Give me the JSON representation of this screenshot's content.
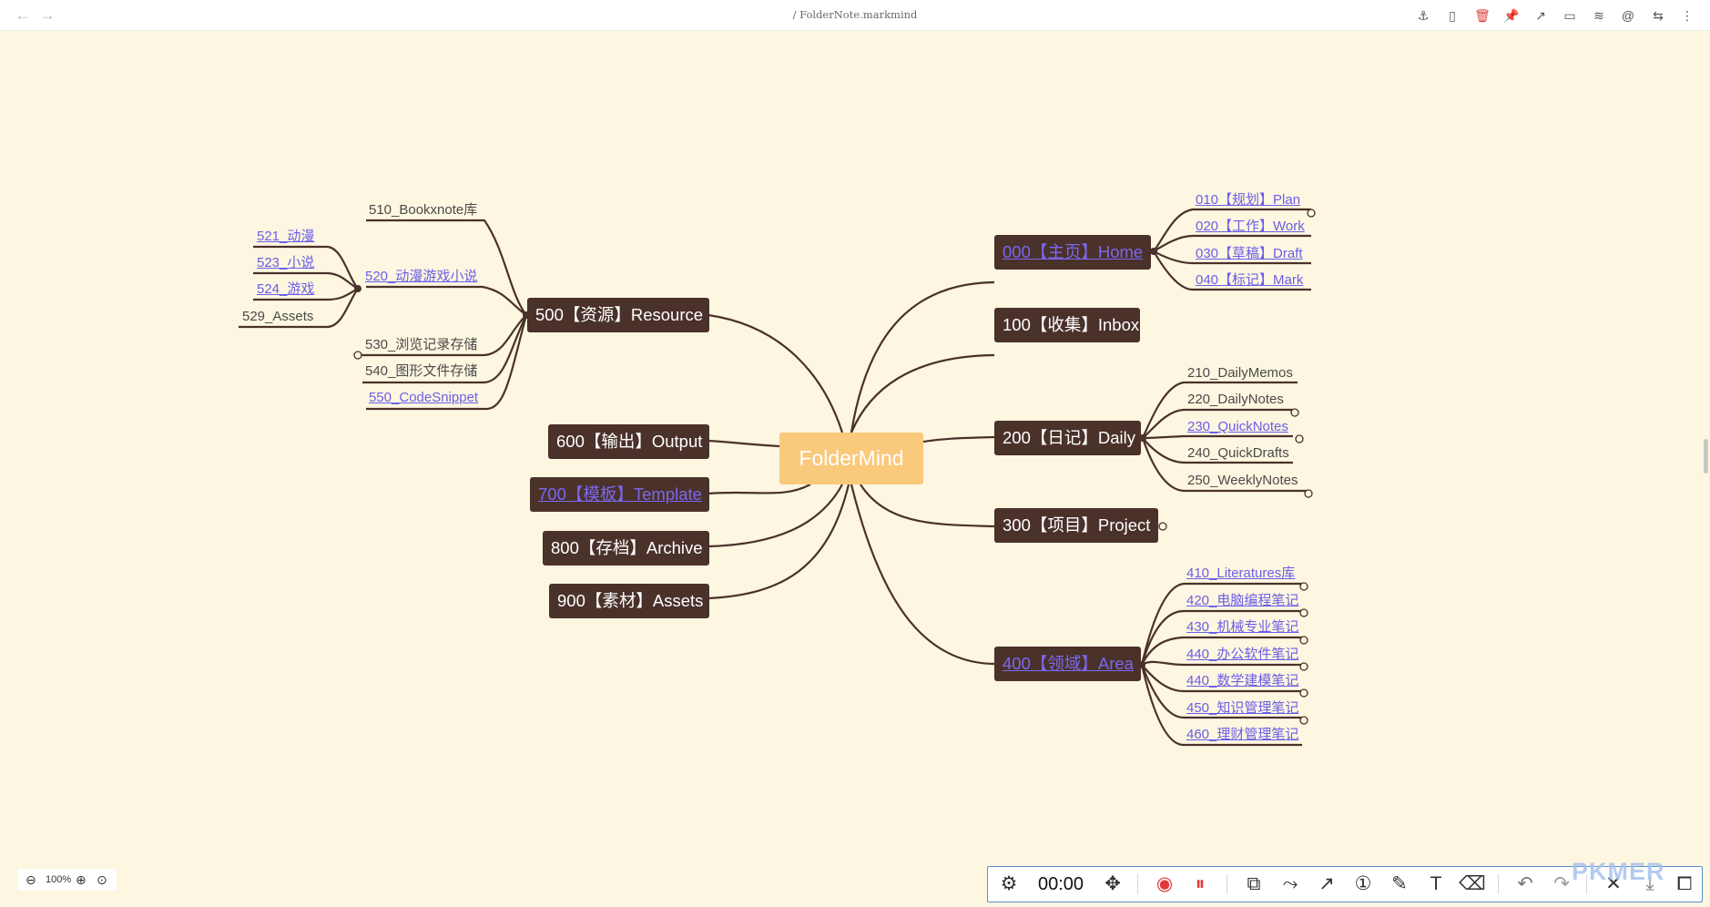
{
  "file_title": "/ FolderNote.markmind",
  "root": "FolderMind",
  "right_nodes": [
    {
      "label": "000【主页】Home",
      "link": true
    },
    {
      "label": "100【收集】Inbox",
      "link": false
    },
    {
      "label": "200【日记】Daily",
      "link": false
    },
    {
      "label": "300【项目】Project",
      "link": false
    },
    {
      "label": "400【领域】Area",
      "link": true
    }
  ],
  "left_nodes": [
    {
      "label": "500【资源】Resource",
      "link": false
    },
    {
      "label": "600【输出】Output",
      "link": false
    },
    {
      "label": "700【模板】Template",
      "link": true
    },
    {
      "label": "800【存档】Archive",
      "link": false
    },
    {
      "label": "900【素材】Assets",
      "link": false
    }
  ],
  "home_children": [
    "010【规划】Plan",
    "020【工作】Work",
    "030【草稿】Draft",
    "040【标记】Mark"
  ],
  "daily_children": [
    "210_DailyMemos",
    "220_DailyNotes",
    "230_QuickNotes",
    "240_QuickDrafts",
    "250_WeeklyNotes"
  ],
  "area_children": [
    "410_Literatures库",
    "420_电脑编程笔记",
    "430_机械专业笔记",
    "440_办公软件笔记",
    "440_数学建模笔记",
    "450_知识管理笔记",
    "460_理财管理笔记"
  ],
  "resource_children": [
    "510_Bookxnote库",
    "520_动漫游戏小说",
    "530_浏览记录存储",
    "540_图形文件存储",
    "550_CodeSnippet"
  ],
  "anime_children": [
    "521_动漫",
    "523_小说",
    "524_游戏",
    "529_Assets"
  ],
  "zoom": {
    "level": "100%"
  },
  "toolbar": {
    "timer": "00:00"
  },
  "watermark": "PKMER",
  "colors": {
    "node_bg": "#4a312a",
    "root_bg": "#f9c97c",
    "link": "#6b5ee8",
    "canvas": "#fdf6e0",
    "edge": "#4a312a"
  }
}
